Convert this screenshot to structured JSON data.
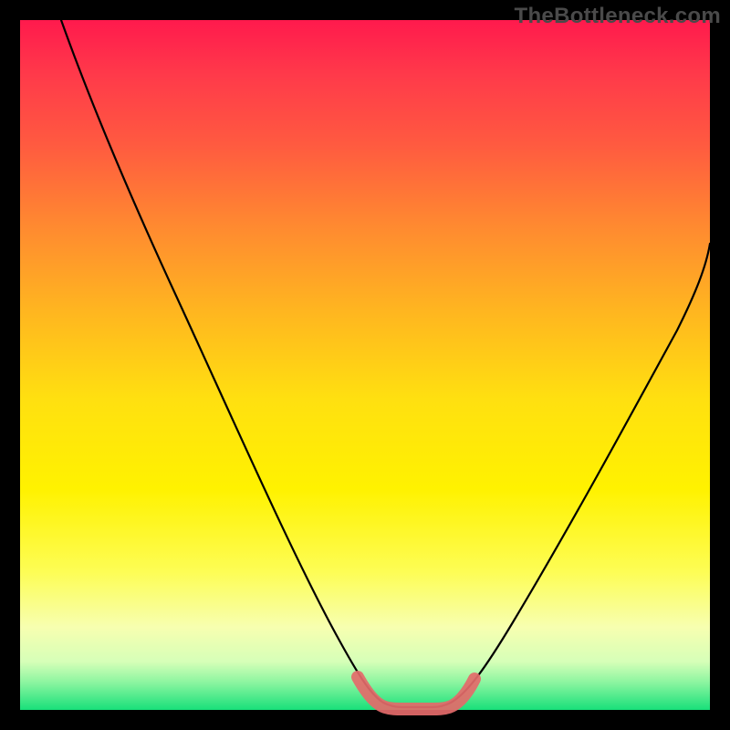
{
  "watermark": "TheBottleneck.com",
  "chart_data": {
    "type": "line",
    "title": "",
    "xlabel": "",
    "ylabel": "",
    "xlim": [
      0,
      100
    ],
    "ylim": [
      0,
      100
    ],
    "series": [
      {
        "name": "bottleneck-curve",
        "x": [
          6,
          10,
          15,
          20,
          25,
          30,
          35,
          40,
          45,
          48,
          50,
          52,
          54,
          56,
          58,
          60,
          62,
          65,
          70,
          75,
          80,
          85,
          90,
          95,
          100
        ],
        "y": [
          100,
          92,
          82,
          72,
          62,
          52,
          42,
          32,
          20,
          10,
          4,
          1,
          0,
          0,
          0,
          0,
          1,
          3,
          10,
          20,
          32,
          44,
          55,
          63,
          68
        ]
      }
    ],
    "highlight_segment": {
      "name": "optimal-range",
      "x": [
        48,
        50,
        52,
        54,
        56,
        58,
        60,
        62
      ],
      "y": [
        5,
        2,
        0.5,
        0,
        0,
        0,
        0.5,
        2
      ]
    },
    "colors": {
      "curve": "#000000",
      "highlight": "#e46a6a",
      "gradient_top": "#ff1a4d",
      "gradient_bottom": "#18e07a"
    }
  }
}
